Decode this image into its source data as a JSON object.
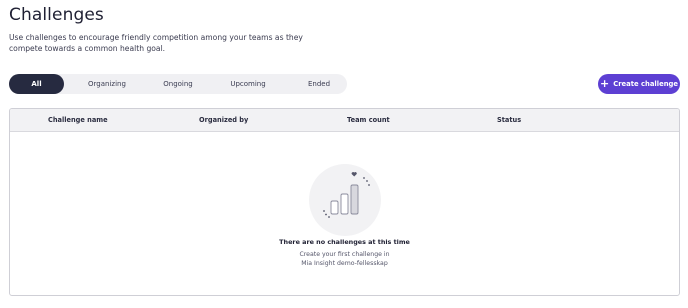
{
  "page": {
    "title": "Challenges",
    "description": "Use challenges to encourage friendly competition among your teams as they compete towards a common health goal."
  },
  "tabs": [
    {
      "label": "All",
      "active": true
    },
    {
      "label": "Organizing",
      "active": false
    },
    {
      "label": "Ongoing",
      "active": false
    },
    {
      "label": "Upcoming",
      "active": false
    },
    {
      "label": "Ended",
      "active": false
    }
  ],
  "actions": {
    "create_label": "Create challenge",
    "create_icon": "plus-icon"
  },
  "table": {
    "columns": [
      "Challenge name",
      "Organized by",
      "Team count",
      "Status"
    ],
    "rows": []
  },
  "empty_state": {
    "icon": "bar-chart-heart-icon",
    "title": "There are no challenges at this time",
    "subtitle_line1": "Create your first challenge in",
    "subtitle_line2": "Mia Insight demo-fellesskap"
  },
  "colors": {
    "accent": "#5d3fd3",
    "active_tab": "#262a40",
    "tab_bg": "#f0f0f3",
    "header_bg": "#f2f2f4"
  }
}
